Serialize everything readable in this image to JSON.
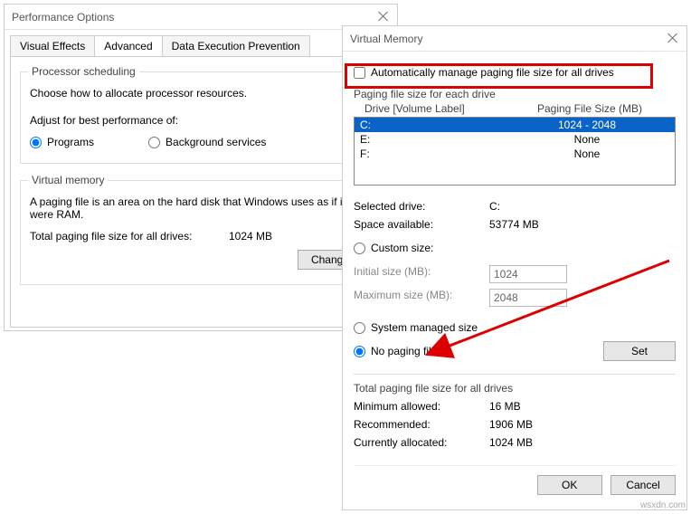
{
  "win1": {
    "title": "Performance Options",
    "tabs": [
      "Visual Effects",
      "Advanced",
      "Data Execution Prevention"
    ],
    "active_tab": 1,
    "proc_sched": {
      "title": "Processor scheduling",
      "desc": "Choose how to allocate processor resources.",
      "adjust_label": "Adjust for best performance of:",
      "opt_programs": "Programs",
      "opt_bg": "Background services"
    },
    "vm": {
      "title": "Virtual memory",
      "desc": "A paging file is an area on the hard disk that Windows uses as if it were RAM.",
      "total_label": "Total paging file size for all drives:",
      "total_value": "1024 MB",
      "change_btn": "Change..."
    }
  },
  "win2": {
    "title": "Virtual Memory",
    "auto_label": "Automatically manage paging file size for all drives",
    "drive_group": "Paging file size for each drive",
    "col_drive": "Drive  [Volume Label]",
    "col_size": "Paging File Size (MB)",
    "drives": [
      {
        "d": "C:",
        "s": "1024 - 2048",
        "sel": true
      },
      {
        "d": "E:",
        "s": "None",
        "sel": false
      },
      {
        "d": "F:",
        "s": "None",
        "sel": false
      }
    ],
    "selected_drive_label": "Selected drive:",
    "selected_drive": "C:",
    "space_label": "Space available:",
    "space": "53774 MB",
    "custom_label": "Custom size:",
    "init_label": "Initial size (MB):",
    "init_val": "1024",
    "max_label": "Maximum size (MB):",
    "max_val": "2048",
    "sys_label": "System managed size",
    "none_label": "No paging file",
    "set_btn": "Set",
    "total_group": "Total paging file size for all drives",
    "min_label": "Minimum allowed:",
    "min_val": "16 MB",
    "rec_label": "Recommended:",
    "rec_val": "1906 MB",
    "cur_label": "Currently allocated:",
    "cur_val": "1024 MB",
    "ok": "OK",
    "cancel": "Cancel"
  },
  "watermark": "wsxdn.com"
}
